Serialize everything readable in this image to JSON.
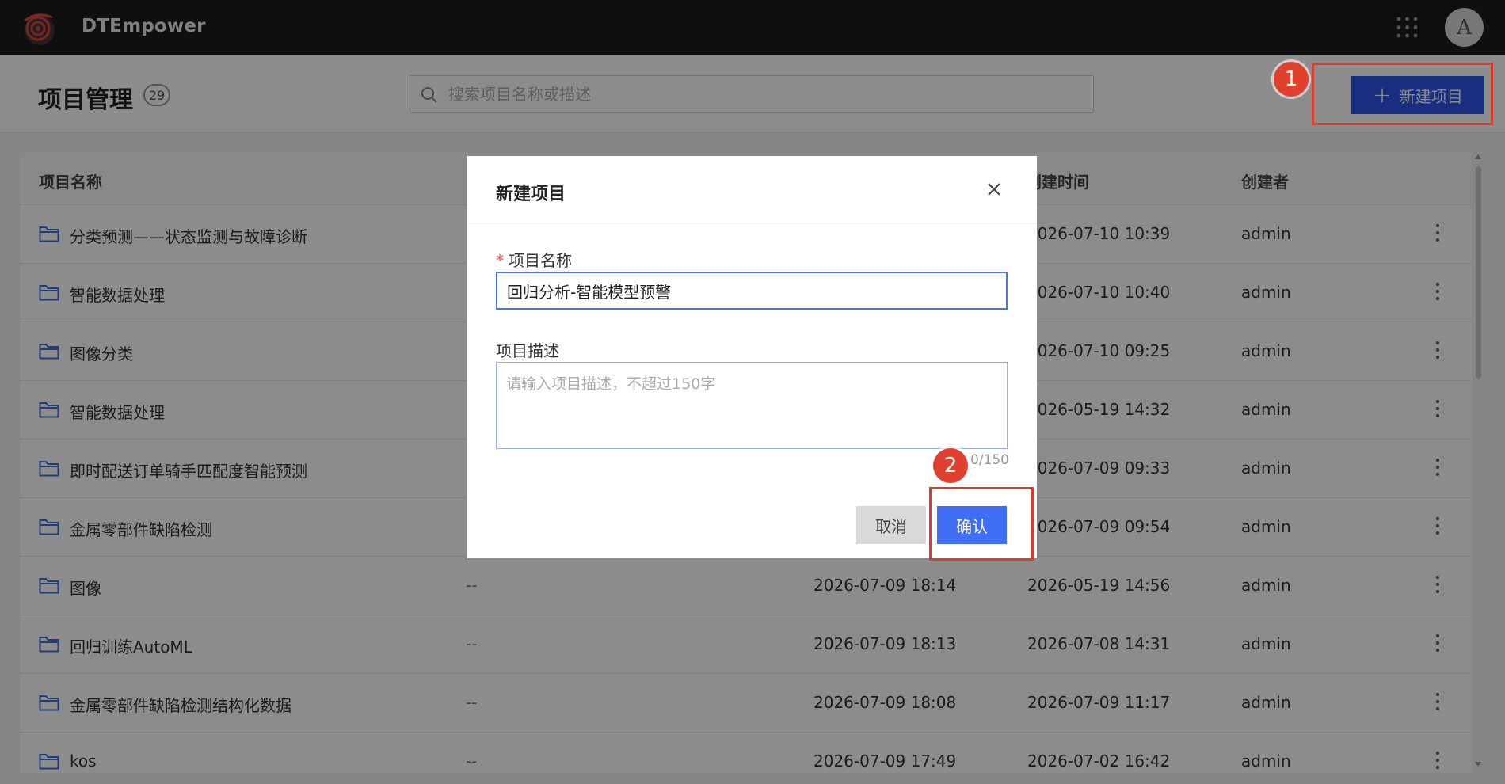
{
  "app": {
    "name": "DTEmpower",
    "avatar_letter": "A"
  },
  "page": {
    "title": "项目管理",
    "count": "29",
    "search_placeholder": "搜索项目名称或描述",
    "new_button_label": "新建项目"
  },
  "table": {
    "headers": {
      "name": "项目名称",
      "created_time": "创建时间",
      "creator": "创建者"
    },
    "rows": [
      {
        "name": "分类预测——状态监测与故障诊断",
        "desc": "",
        "updated": "",
        "created": "2026-07-10 10:39",
        "creator": "admin"
      },
      {
        "name": "智能数据处理",
        "desc": "",
        "updated": "",
        "created": "2026-07-10 10:40",
        "creator": "admin"
      },
      {
        "name": "图像分类",
        "desc": "",
        "updated": "",
        "created": "2026-07-10 09:25",
        "creator": "admin"
      },
      {
        "name": "智能数据处理",
        "desc": "",
        "updated": "",
        "created": "2026-05-19 14:32",
        "creator": "admin"
      },
      {
        "name": "即时配送订单骑手匹配度智能预测",
        "desc": "",
        "updated": "",
        "created": "2026-07-09 09:33",
        "creator": "admin"
      },
      {
        "name": "金属零部件缺陷检测",
        "desc": "",
        "updated": "",
        "created": "2026-07-09 09:54",
        "creator": "admin"
      },
      {
        "name": "图像",
        "desc": "--",
        "updated": "2026-07-09 18:14",
        "created": "2026-05-19 14:56",
        "creator": "admin"
      },
      {
        "name": "回归训练AutoML",
        "desc": "--",
        "updated": "2026-07-09 18:13",
        "created": "2026-07-08 14:31",
        "creator": "admin"
      },
      {
        "name": "金属零部件缺陷检测结构化数据",
        "desc": "--",
        "updated": "2026-07-09 18:08",
        "created": "2026-07-09 11:17",
        "creator": "admin"
      },
      {
        "name": "kos",
        "desc": "--",
        "updated": "2026-07-09 17:49",
        "created": "2026-07-02 16:42",
        "creator": "admin"
      }
    ]
  },
  "modal": {
    "title": "新建项目",
    "name_label": "项目名称",
    "required_mark": "*",
    "name_value": "回归分析-智能模型预警",
    "desc_label": "项目描述",
    "desc_placeholder": "请输入项目描述，不超过150字",
    "char_count": "0/150",
    "cancel_label": "取消",
    "confirm_label": "确认"
  },
  "annotations": {
    "step1": "1",
    "step2": "2",
    "highlight_color": "#e03a2a"
  },
  "colors": {
    "primary": "#2f54eb",
    "topbar": "#1c1c1e"
  }
}
